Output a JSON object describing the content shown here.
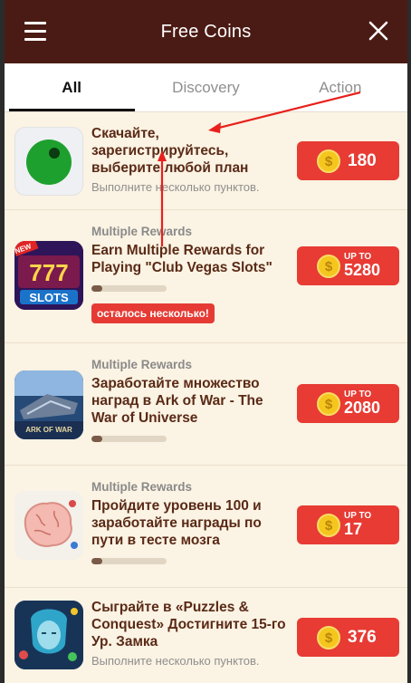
{
  "header": {
    "title": "Free Coins",
    "menu_icon": "hamburger-menu-icon",
    "close_icon": "close-icon"
  },
  "tabs": [
    {
      "label": "All",
      "active": true
    },
    {
      "label": "Discovery",
      "active": false
    },
    {
      "label": "Action",
      "active": false
    }
  ],
  "offers": [
    {
      "icon": "green-ball-app-icon",
      "subtitle": "",
      "title": "Скачайте, зарегистрируйтесь, выберите любой план",
      "hint": "Выполните несколько пунктов.",
      "progress": null,
      "badge": "",
      "reward_prefix": "",
      "reward": "180"
    },
    {
      "icon": "vegas-slots-777-icon",
      "subtitle": "Multiple Rewards",
      "title": "Earn Multiple Rewards for Playing \"Club Vegas Slots\"",
      "hint": "",
      "progress": 0.15,
      "badge": "осталось несколько!",
      "reward_prefix": "UP TO",
      "reward": "5280"
    },
    {
      "icon": "ark-of-war-icon",
      "subtitle": "Multiple Rewards",
      "title": "Заработайте множество наград в Ark of War - The War of Universe",
      "hint": "",
      "progress": 0.15,
      "badge": "",
      "reward_prefix": "UP TO",
      "reward": "2080"
    },
    {
      "icon": "brain-test-icon",
      "subtitle": "Multiple Rewards",
      "title": "Пройдите уровень 100 и заработайте награды по пути в тесте мозга",
      "hint": "",
      "progress": 0.15,
      "badge": "",
      "reward_prefix": "UP TO",
      "reward": "17"
    },
    {
      "icon": "puzzles-conquest-icon",
      "subtitle": "",
      "title": "Сыграйте в «Puzzles & Conquest» Достигните 15-го Ур. Замка",
      "hint": "Выполните несколько пунктов.",
      "progress": null,
      "badge": "",
      "reward_prefix": "",
      "reward": "376"
    }
  ],
  "colors": {
    "header_bg": "#4a1b14",
    "reward_bg": "#e73b34",
    "coin": "#f4c61e",
    "annotation_arrow": "#e8201c"
  }
}
